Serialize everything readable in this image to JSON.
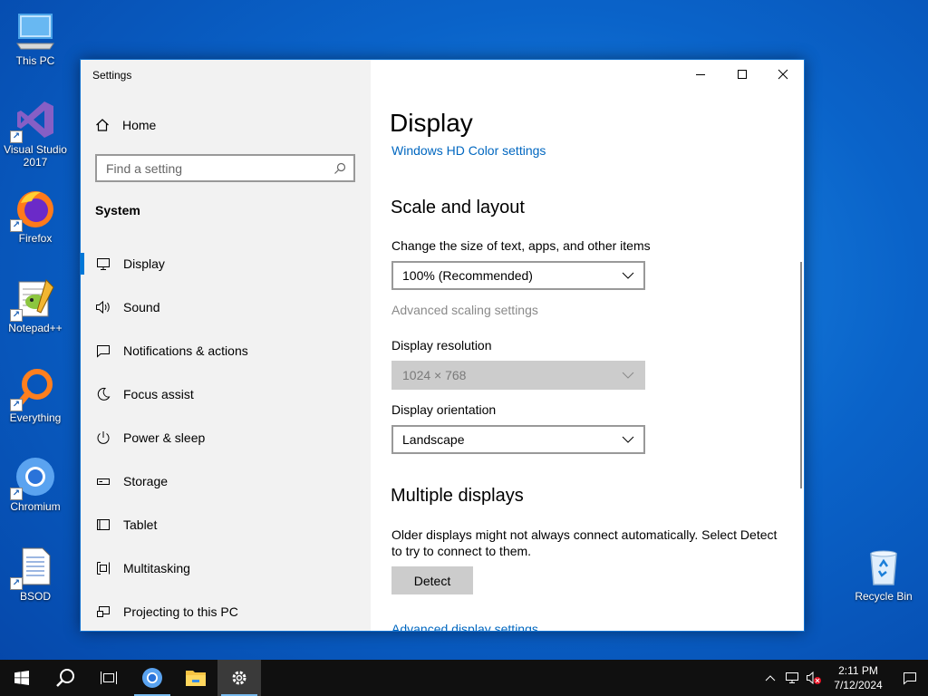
{
  "desktop": {
    "icons": [
      {
        "label": "This PC",
        "icon": "computer-icon"
      },
      {
        "label": "Visual Studio 2017",
        "icon": "visual-studio-icon"
      },
      {
        "label": "Firefox",
        "icon": "firefox-icon"
      },
      {
        "label": "Notepad++",
        "icon": "notepadpp-icon"
      },
      {
        "label": "Everything",
        "icon": "everything-search-icon"
      },
      {
        "label": "Chromium",
        "icon": "chromium-icon"
      },
      {
        "label": "BSOD",
        "icon": "document-icon"
      },
      {
        "label": "Recycle Bin",
        "icon": "recycle-bin-icon"
      }
    ]
  },
  "window": {
    "title": "Settings",
    "controls": {
      "minimize": "minimize-icon",
      "maximize": "maximize-icon",
      "close": "close-icon"
    }
  },
  "sidebar": {
    "home_label": "Home",
    "search_placeholder": "Find a setting",
    "section_label": "System",
    "items": [
      {
        "label": "Display",
        "icon": "monitor-icon",
        "active": true
      },
      {
        "label": "Sound",
        "icon": "speaker-icon"
      },
      {
        "label": "Notifications & actions",
        "icon": "notification-icon"
      },
      {
        "label": "Focus assist",
        "icon": "moon-icon"
      },
      {
        "label": "Power & sleep",
        "icon": "power-icon"
      },
      {
        "label": "Storage",
        "icon": "storage-icon"
      },
      {
        "label": "Tablet",
        "icon": "tablet-icon"
      },
      {
        "label": "Multitasking",
        "icon": "multitasking-icon"
      },
      {
        "label": "Projecting to this PC",
        "icon": "projecting-icon"
      }
    ]
  },
  "content": {
    "page_title": "Display",
    "hd_color_link": "Windows HD Color settings",
    "scale_heading": "Scale and layout",
    "scale_label": "Change the size of text, apps, and other items",
    "scale_value": "100% (Recommended)",
    "advanced_scaling_link": "Advanced scaling settings",
    "resolution_label": "Display resolution",
    "resolution_value": "1024 × 768",
    "orientation_label": "Display orientation",
    "orientation_value": "Landscape",
    "multiple_heading": "Multiple displays",
    "multiple_desc": "Older displays might not always connect automatically. Select Detect to try to connect to them.",
    "detect_button": "Detect",
    "advanced_display_link": "Advanced display settings"
  },
  "taskbar": {
    "clock_time": "2:11 PM",
    "clock_date": "7/12/2024",
    "apps": [
      "start-icon",
      "search-icon",
      "task-view-icon",
      "chromium-icon",
      "file-explorer-icon",
      "settings-gear-icon"
    ]
  },
  "colors": {
    "accent": "#0078d7",
    "link": "#0067c0",
    "taskbar": "#101010",
    "sidebar_bg": "#f2f2f2"
  }
}
